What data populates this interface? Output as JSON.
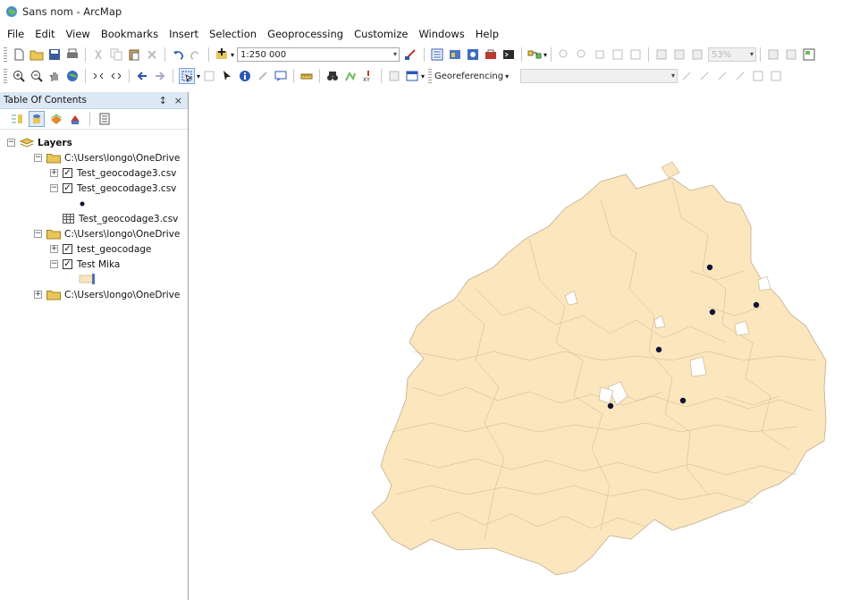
{
  "window": {
    "title": "Sans nom - ArcMap"
  },
  "menu": [
    "File",
    "Edit",
    "View",
    "Bookmarks",
    "Insert",
    "Selection",
    "Geoprocessing",
    "Customize",
    "Windows",
    "Help"
  ],
  "toolbar": {
    "scale_value": "1:250 000",
    "zoom_value": "53%",
    "georeferencing_label": "Georeferencing",
    "layer_combo_value": ""
  },
  "toc": {
    "title": "Table Of Contents",
    "pin_glyph": "↕",
    "close_glyph": "×",
    "root_label": "Layers",
    "groups": [
      {
        "path": "C:\\Users\\longo\\OneDrive",
        "layers": [
          {
            "name": "Test_geocodage3.csv",
            "checked": true,
            "expanded": false
          },
          {
            "name": "Test_geocodage3.csv",
            "checked": true,
            "expanded": true,
            "symbol": "point"
          },
          {
            "name": "Test_geocodage3.csv",
            "type": "table"
          }
        ]
      },
      {
        "path": "C:\\Users\\longo\\OneDrive",
        "layers": [
          {
            "name": "test_geocodage",
            "checked": true,
            "expanded": false
          },
          {
            "name": "Test Mika",
            "checked": true,
            "expanded": true,
            "symbol": "polygon"
          }
        ]
      },
      {
        "path": "C:\\Users\\longo\\OneDrive",
        "expanded": false
      }
    ]
  },
  "map": {
    "polygon_fill": "#fbe6bd",
    "polygon_stroke": "#bfae8f",
    "point_color": "#0f1135",
    "background": "#ffffff",
    "points_count_shown": 6
  },
  "colors": {
    "toc_header": "#dde8f5",
    "folder": "#e8c65a"
  }
}
